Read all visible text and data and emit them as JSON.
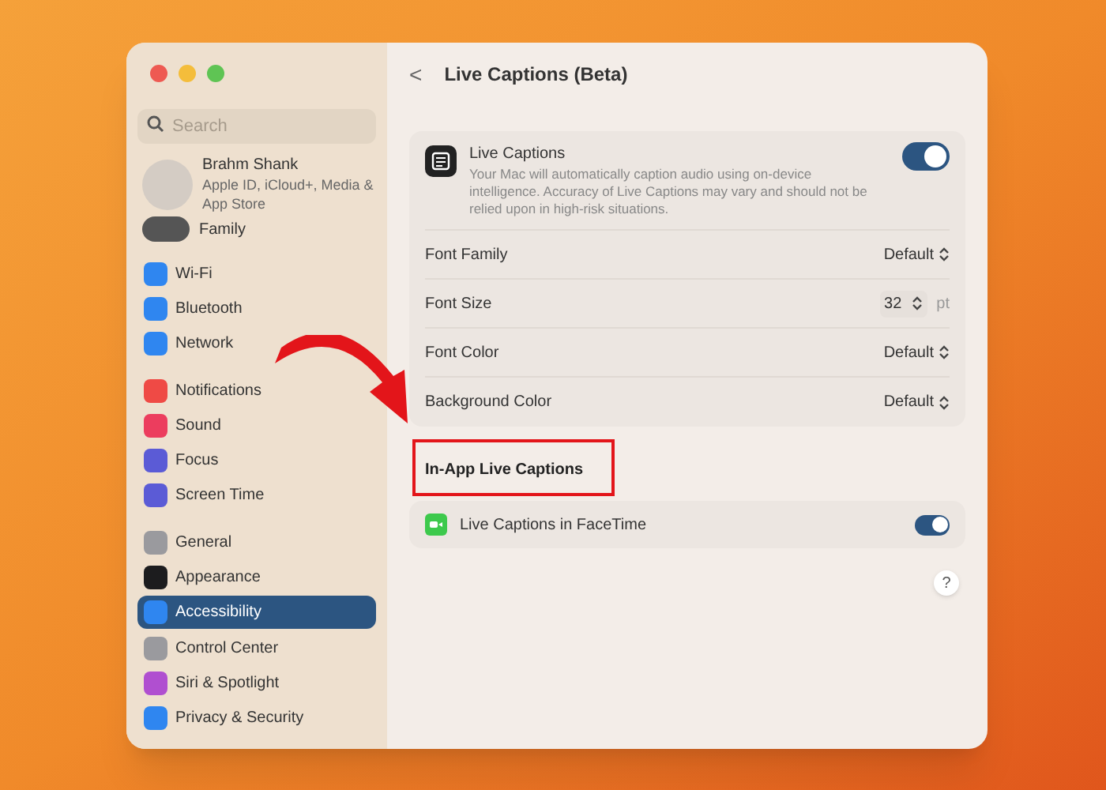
{
  "sidebar": {
    "search": {
      "placeholder": "Search"
    },
    "account": {
      "name": "Brahm Shank",
      "detail": "Apple ID, iCloud+, Media & App Store"
    },
    "family": {
      "label": "Family"
    },
    "groups": [
      {
        "items": [
          {
            "label": "Wi-Fi",
            "color": "#2f86f0",
            "selected": false
          },
          {
            "label": "Bluetooth",
            "color": "#2f86f0",
            "selected": false
          },
          {
            "label": "Network",
            "color": "#2f86f0",
            "selected": false
          }
        ]
      },
      {
        "items": [
          {
            "label": "Notifications",
            "color": "#ef4a45",
            "selected": false
          },
          {
            "label": "Sound",
            "color": "#ec3d5e",
            "selected": false
          },
          {
            "label": "Focus",
            "color": "#5b5bd6",
            "selected": false
          },
          {
            "label": "Screen Time",
            "color": "#5b5bd6",
            "selected": false
          }
        ]
      },
      {
        "items": [
          {
            "label": "General",
            "color": "#9a9a9e",
            "selected": false
          },
          {
            "label": "Appearance",
            "color": "#1c1c1e",
            "selected": false
          },
          {
            "label": "Accessibility",
            "color": "#2f86f0",
            "selected": true
          },
          {
            "label": "Control Center",
            "color": "#9a9a9e",
            "selected": false
          },
          {
            "label": "Siri & Spotlight",
            "color": "#b04fd0",
            "selected": false
          },
          {
            "label": "Privacy & Security",
            "color": "#2f86f0",
            "selected": false
          }
        ]
      }
    ]
  },
  "header": {
    "back": "<",
    "title": "Live Captions (Beta)"
  },
  "main_card": {
    "title": "Live Captions",
    "description": "Your Mac will automatically caption audio using on-device intelligence. Accuracy of Live Captions may vary and should not be relied upon in high-risk situations.",
    "on": true,
    "rows": [
      {
        "kind": "popup",
        "label": "Font Family",
        "value": "Default"
      },
      {
        "kind": "stepper",
        "label": "Font Size",
        "value": "32",
        "unit": "pt"
      },
      {
        "kind": "popup",
        "label": "Font Color",
        "value": "Default"
      },
      {
        "kind": "popup",
        "label": "Background Color",
        "value": "Default"
      }
    ]
  },
  "section_heading": "In-App Live Captions",
  "facetime_row": {
    "label": "Live Captions in FaceTime",
    "on": true
  },
  "help": "?"
}
